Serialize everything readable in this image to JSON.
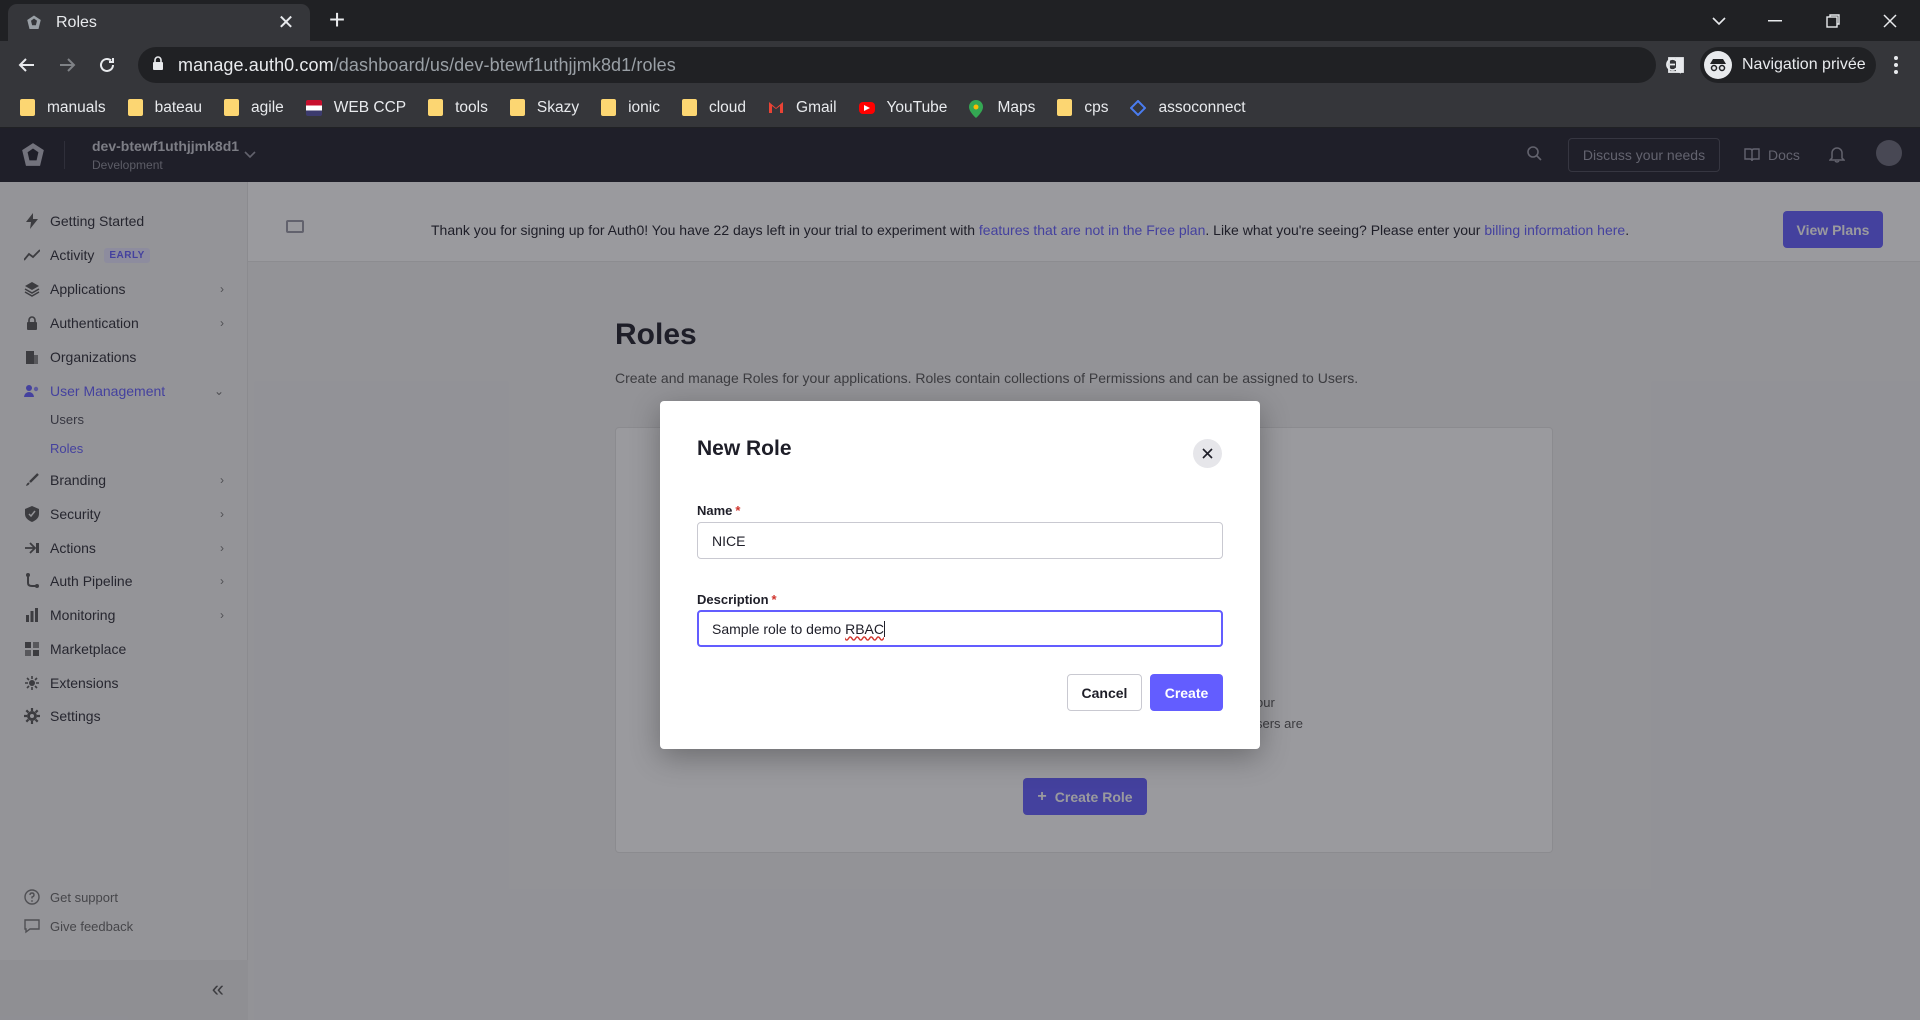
{
  "browser": {
    "tab_title": "Roles",
    "url_host": "manage.auth0.com",
    "url_path": "/dashboard/us/dev-btewf1uthjjmk8d1/roles",
    "profile_label": "Navigation privée",
    "bookmarks": [
      {
        "label": "manuals",
        "icon": "folder-icon"
      },
      {
        "label": "bateau",
        "icon": "folder-icon"
      },
      {
        "label": "agile",
        "icon": "folder-icon"
      },
      {
        "label": "WEB CCP",
        "icon": "flag-icon"
      },
      {
        "label": "tools",
        "icon": "folder-icon"
      },
      {
        "label": "Skazy",
        "icon": "folder-icon"
      },
      {
        "label": "ionic",
        "icon": "folder-icon"
      },
      {
        "label": "cloud",
        "icon": "folder-icon"
      },
      {
        "label": "Gmail",
        "icon": "gmail-icon"
      },
      {
        "label": "YouTube",
        "icon": "youtube-icon"
      },
      {
        "label": "Maps",
        "icon": "maps-icon"
      },
      {
        "label": "cps",
        "icon": "folder-icon"
      },
      {
        "label": "assoconnect",
        "icon": "assoconnect-icon"
      }
    ]
  },
  "header": {
    "tenant_name": "dev-btewf1uthjjmk8d1",
    "tenant_env": "Development",
    "discuss_label": "Discuss your needs",
    "docs_label": "Docs"
  },
  "sidebar": {
    "items": [
      {
        "label": "Getting Started",
        "icon": "bolt-icon"
      },
      {
        "label": "Activity",
        "icon": "activity-icon",
        "badge": "EARLY"
      },
      {
        "label": "Applications",
        "icon": "stack-icon"
      },
      {
        "label": "Authentication",
        "icon": "lock-icon"
      },
      {
        "label": "Organizations",
        "icon": "building-icon"
      },
      {
        "label": "User Management",
        "icon": "users-icon"
      },
      {
        "label": "Branding",
        "icon": "brush-icon"
      },
      {
        "label": "Security",
        "icon": "shield-icon"
      },
      {
        "label": "Actions",
        "icon": "actions-icon"
      },
      {
        "label": "Auth Pipeline",
        "icon": "pipeline-icon"
      },
      {
        "label": "Monitoring",
        "icon": "chart-icon"
      },
      {
        "label": "Marketplace",
        "icon": "grid-icon"
      },
      {
        "label": "Extensions",
        "icon": "extension-icon"
      },
      {
        "label": "Settings",
        "icon": "gear-icon"
      }
    ],
    "sub_items": [
      {
        "label": "Users"
      },
      {
        "label": "Roles"
      }
    ],
    "footer": [
      {
        "label": "Get support",
        "icon": "help-icon"
      },
      {
        "label": "Give feedback",
        "icon": "feedback-icon"
      }
    ]
  },
  "banner": {
    "text_1": "Thank you for signing up for Auth0! You have 22 days left in your trial to experiment with ",
    "link_1": "features that are not in the Free plan",
    "text_2": ". Like what you're seeing? Please enter your ",
    "link_2": "billing information here",
    "text_3": ".",
    "button": "View Plans"
  },
  "main": {
    "title": "Roles",
    "subtitle": "Create and manage Roles for your applications. Roles contain collections of Permissions and can be assigned to Users.",
    "empty_fragment_1": "our",
    "empty_fragment_2": "sers are",
    "create_button": "Create Role"
  },
  "modal": {
    "title": "New Role",
    "name_label": "Name",
    "name_value": "NICE",
    "description_label": "Description",
    "description_value_1": "Sample role to demo ",
    "description_value_2": "RBAC",
    "required_mark": "*",
    "cancel_label": "Cancel",
    "create_label": "Create"
  },
  "colors": {
    "accent": "#635dff",
    "header_bg": "#20202a",
    "required": "#d0342c"
  }
}
